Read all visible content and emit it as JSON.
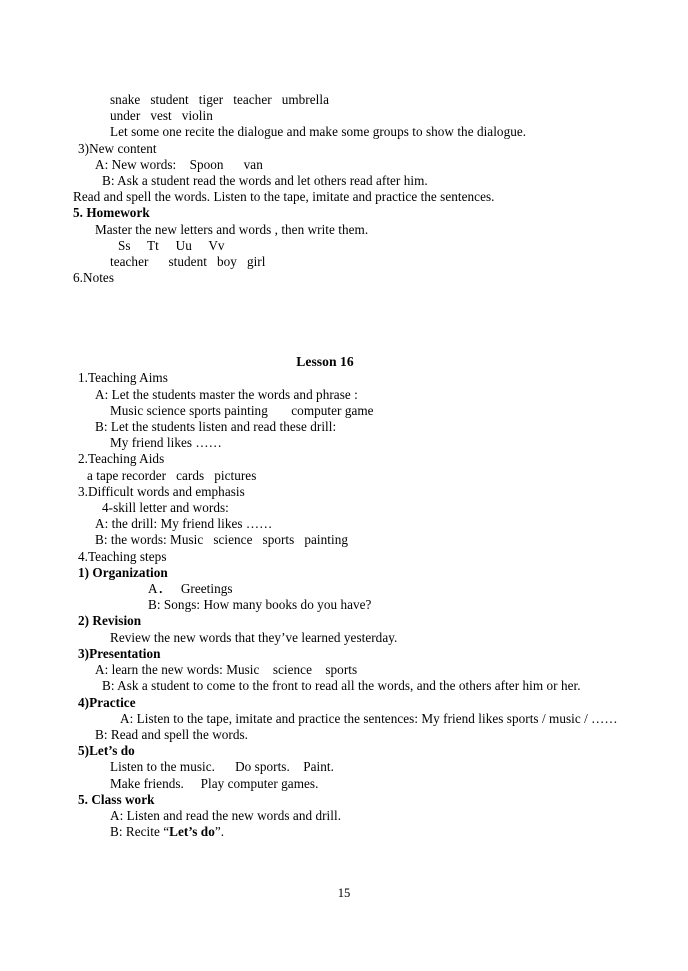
{
  "document": {
    "page_number": "15",
    "section_previous": {
      "lines": [
        {
          "id": "prev_words_1",
          "text": "snake   student   tiger   teacher   umbrella",
          "indent": "i4",
          "bold": false
        },
        {
          "id": "prev_words_2",
          "text": "under   vest   violin",
          "indent": "i4",
          "bold": false
        },
        {
          "id": "prev_recite",
          "text": "Let some one recite the dialogue and make some groups to show the dialogue.",
          "indent": "i4",
          "bold": false
        },
        {
          "id": "prev_new_content",
          "text": "3)New content",
          "indent": "i0",
          "bold": false
        },
        {
          "id": "prev_new_words",
          "text": "A: New words:    Spoon      van",
          "indent": "i2",
          "bold": false
        },
        {
          "id": "prev_ask_student",
          "text": "B: Ask a student read the words and let others read after him.",
          "indent": "i3",
          "bold": false
        },
        {
          "id": "prev_read_spell",
          "text": "Read and spell the words. Listen to the tape, imitate and practice the sentences.",
          "indent": "i0",
          "bold": false
        },
        {
          "id": "prev_homework_heading",
          "text": "5. Homework",
          "indent": "i0",
          "bold": true
        },
        {
          "id": "prev_master",
          "text": "Master the new letters and words , then write them.",
          "indent": "i2",
          "bold": false
        },
        {
          "id": "prev_letters",
          "text": "Ss     Tt     Uu     Vv",
          "indent": "i5",
          "bold": false
        },
        {
          "id": "prev_words_3",
          "text": "teacher      student   boy   girl",
          "indent": "i4",
          "bold": false
        },
        {
          "id": "prev_notes",
          "text": "6.Notes",
          "indent": "i0",
          "bold": false
        }
      ]
    },
    "lesson": {
      "title": "Lesson 16",
      "items": [
        {
          "id": "teaching_aims_heading",
          "text": "1.Teaching Aims",
          "indent": "i0",
          "bold": false
        },
        {
          "id": "aims_a",
          "text": "A: Let the students master the words and phrase :",
          "indent": "i2",
          "bold": false
        },
        {
          "id": "aims_a_words",
          "text": "Music science sports painting       computer game",
          "indent": "i4",
          "bold": false
        },
        {
          "id": "aims_b",
          "text": "B: Let the students listen and read these drill:",
          "indent": "i2",
          "bold": false
        },
        {
          "id": "aims_b_drill",
          "text": "My friend likes ……",
          "indent": "i4",
          "bold": false
        },
        {
          "id": "teaching_aids_heading",
          "text": "2.Teaching Aids",
          "indent": "i0",
          "bold": false
        },
        {
          "id": "aids_list",
          "text": "a tape recorder   cards   pictures",
          "indent": "i1",
          "bold": false
        },
        {
          "id": "difficult_words_heading",
          "text": "3.Difficult words and emphasis",
          "indent": "i0",
          "bold": false
        },
        {
          "id": "four_skill",
          "text": "4-skill letter and words:",
          "indent": "i3",
          "bold": false
        },
        {
          "id": "difficult_a",
          "text": "A: the drill: My friend likes ……",
          "indent": "i2",
          "bold": false
        },
        {
          "id": "difficult_b",
          "text": "B: the words: Music   science   sports   painting",
          "indent": "i2",
          "bold": false
        },
        {
          "id": "teaching_steps_heading",
          "text": "4.Teaching steps",
          "indent": "i0",
          "bold": false
        },
        {
          "id": "organization_heading",
          "text": "1) Organization",
          "indent": "i0",
          "bold": true
        },
        {
          "id": "org_a",
          "text": "A．   Greetings",
          "indent": "i8",
          "bold": false
        },
        {
          "id": "org_b",
          "text": "B: Songs: How many books do you have?",
          "indent": "i8",
          "bold": false
        },
        {
          "id": "revision_heading",
          "text": "2) Revision",
          "indent": "i0",
          "bold": true
        },
        {
          "id": "revision_body",
          "text": "Review the new words that they’ve learned yesterday.",
          "indent": "i4",
          "bold": false
        },
        {
          "id": "presentation_heading",
          "text": "3)Presentation",
          "indent": "i0",
          "bold": true
        },
        {
          "id": "presentation_a",
          "text": "A: learn the new words: Music    science    sports",
          "indent": "i2",
          "bold": false
        },
        {
          "id": "presentation_b",
          "text": "B: Ask a student to come to the front to read all the words, and the others after him or her.",
          "indent": "i3",
          "bold": false,
          "style": "hang"
        },
        {
          "id": "practice_heading",
          "text": "4)Practice",
          "indent": "i0",
          "bold": true
        },
        {
          "id": "practice_a",
          "text": "A: Listen to the tape, imitate and practice the sentences: My friend likes sports / music / ……",
          "indent": "i3",
          "bold": false,
          "style": "justify-hang"
        },
        {
          "id": "practice_b",
          "text": "B: Read and spell the words.",
          "indent": "i2",
          "bold": false
        },
        {
          "id": "letsdo_heading",
          "text": "5)Let’s do",
          "indent": "i0",
          "bold": true
        },
        {
          "id": "letsdo_1",
          "text": "Listen to the music.      Do sports.    Paint.",
          "indent": "i4",
          "bold": false
        },
        {
          "id": "letsdo_2",
          "text": "Make friends.     Play computer games.",
          "indent": "i4",
          "bold": false
        },
        {
          "id": "classwork_heading",
          "text": "5. Class work",
          "indent": "i0",
          "bold": true
        },
        {
          "id": "classwork_a",
          "text": "A: Listen and read the new words and drill.",
          "indent": "i4",
          "bold": false
        }
      ],
      "classwork_b": {
        "prefix": "B: Recite “",
        "emphasis": "Let’s do",
        "suffix": "”."
      }
    }
  }
}
